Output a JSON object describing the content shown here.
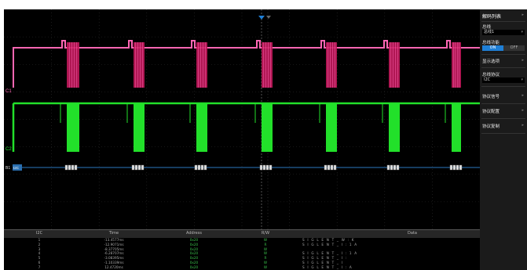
{
  "scope": {
    "trace_labels": {
      "pink": "C1",
      "green": "C2",
      "bus": "B1",
      "bus_tag": "I2C"
    },
    "colors": {
      "pink": "#ff66b3",
      "pink_dim": "#c2185b",
      "green": "#22e02a",
      "bus": "#3aa0ff",
      "grid": "#2c2c2c",
      "marker": "#1f7fd6"
    }
  },
  "decode_table": {
    "headers": [
      "I2C",
      "Time",
      "Address",
      "R/W",
      "Data"
    ],
    "rows": [
      {
        "index": "1",
        "time": "-13.4577ms",
        "address": "0x20",
        "rw": "W",
        "data": "S I G L E N T _ W : K"
      },
      {
        "index": "2",
        "time": "-12.9071ms",
        "address": "0x20",
        "rw": "R",
        "data": "S I G L E N T _ I : 1 A"
      },
      {
        "index": "3",
        "time": "-8.37705ms",
        "address": "0x20",
        "rw": "W",
        "data": ""
      },
      {
        "index": "4",
        "time": "-6.28707ms",
        "address": "0x20",
        "rw": "W",
        "data": "S I G L E N T _ I : 1 A"
      },
      {
        "index": "5",
        "time": "-3.08395ms",
        "address": "0x20",
        "rw": "R",
        "data": "S I G L E N T _ I :"
      },
      {
        "index": "6",
        "time": "-1.10339ms",
        "address": "0x20",
        "rw": "W",
        "data": "S I G L E N T _ I"
      },
      {
        "index": "7",
        "time": "12.4720ms",
        "address": "0x20",
        "rw": "W",
        "data": "S I G L E N T _ I : A"
      }
    ]
  },
  "sidebar": {
    "title": "解码列表",
    "bus_label": "总线",
    "bus_value": "总线1",
    "bus_func_label": "总线功能",
    "toggle_on": "ON",
    "toggle_off": "OFF",
    "display_label": "显示选项",
    "protocol_label": "总线协议",
    "protocol_value": "I2C",
    "signal_label": "协议信号",
    "config_label": "协议配置",
    "copy_label": "协议复制"
  }
}
